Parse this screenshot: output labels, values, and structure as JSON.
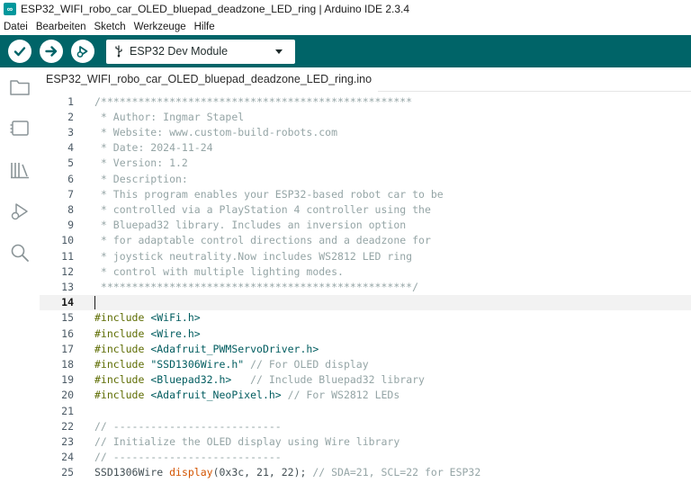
{
  "window": {
    "title": "ESP32_WIFI_robo_car_OLED_bluepad_deadzone_LED_ring | Arduino IDE 2.3.4",
    "app_icon": "arduino-logo-icon"
  },
  "menu": [
    "Datei",
    "Bearbeiten",
    "Sketch",
    "Werkzeuge",
    "Hilfe"
  ],
  "toolbar": {
    "verify_icon": "checkmark-icon",
    "upload_icon": "arrow-right-icon",
    "debug_icon": "debugger-icon",
    "board_icon": "usb-icon",
    "board_label": "ESP32 Dev Module",
    "accent_color": "#006468"
  },
  "sidebar": {
    "icons": [
      "folder-icon",
      "board-manager-icon",
      "library-icon",
      "debug-icon",
      "search-icon"
    ]
  },
  "tab": {
    "label": "ESP32_WIFI_robo_car_OLED_bluepad_deadzone_LED_ring.ino"
  },
  "editor": {
    "current_line": 14,
    "lines": [
      {
        "n": "1",
        "parts": [
          {
            "t": "/**************************************************",
            "c": "comment"
          }
        ]
      },
      {
        "n": "2",
        "parts": [
          {
            "t": " * Author: Ingmar Stapel",
            "c": "comment"
          }
        ]
      },
      {
        "n": "3",
        "parts": [
          {
            "t": " * Website: www.custom-build-robots.com",
            "c": "comment"
          }
        ]
      },
      {
        "n": "4",
        "parts": [
          {
            "t": " * Date: 2024-11-24",
            "c": "comment"
          }
        ]
      },
      {
        "n": "5",
        "parts": [
          {
            "t": " * Version: 1.2",
            "c": "comment"
          }
        ]
      },
      {
        "n": "6",
        "parts": [
          {
            "t": " * Description:",
            "c": "comment"
          }
        ]
      },
      {
        "n": "7",
        "parts": [
          {
            "t": " * This program enables your ESP32-based robot car to be",
            "c": "comment"
          }
        ]
      },
      {
        "n": "8",
        "parts": [
          {
            "t": " * controlled via a PlayStation 4 controller using the",
            "c": "comment"
          }
        ]
      },
      {
        "n": "9",
        "parts": [
          {
            "t": " * Bluepad32 library. Includes an inversion option",
            "c": "comment"
          }
        ]
      },
      {
        "n": "10",
        "parts": [
          {
            "t": " * for adaptable control directions and a deadzone for",
            "c": "comment"
          }
        ]
      },
      {
        "n": "11",
        "parts": [
          {
            "t": " * joystick neutrality.Now includes WS2812 LED ring",
            "c": "comment"
          }
        ]
      },
      {
        "n": "12",
        "parts": [
          {
            "t": " * control with multiple lighting modes.",
            "c": "comment"
          }
        ]
      },
      {
        "n": "13",
        "parts": [
          {
            "t": " **************************************************/",
            "c": "comment"
          }
        ]
      },
      {
        "n": "14",
        "parts": [
          {
            "t": "",
            "c": "plain"
          }
        ]
      },
      {
        "n": "15",
        "parts": [
          {
            "t": "#include",
            "c": "kw"
          },
          {
            "t": " <WiFi.h>",
            "c": "str"
          }
        ]
      },
      {
        "n": "16",
        "parts": [
          {
            "t": "#include",
            "c": "kw"
          },
          {
            "t": " <Wire.h>",
            "c": "str"
          }
        ]
      },
      {
        "n": "17",
        "parts": [
          {
            "t": "#include",
            "c": "kw"
          },
          {
            "t": " <Adafruit_PWMServoDriver.h>",
            "c": "str"
          }
        ]
      },
      {
        "n": "18",
        "parts": [
          {
            "t": "#include",
            "c": "kw"
          },
          {
            "t": " \"SSD1306Wire.h\"",
            "c": "str"
          },
          {
            "t": " // For OLED display",
            "c": "comment"
          }
        ]
      },
      {
        "n": "19",
        "parts": [
          {
            "t": "#include",
            "c": "kw"
          },
          {
            "t": " <Bluepad32.h>",
            "c": "str"
          },
          {
            "t": "   // Include Bluepad32 library",
            "c": "comment"
          }
        ]
      },
      {
        "n": "20",
        "parts": [
          {
            "t": "#include",
            "c": "kw"
          },
          {
            "t": " <Adafruit_NeoPixel.h>",
            "c": "str"
          },
          {
            "t": " // For WS2812 LEDs",
            "c": "comment"
          }
        ]
      },
      {
        "n": "21",
        "parts": [
          {
            "t": "",
            "c": "plain"
          }
        ]
      },
      {
        "n": "22",
        "parts": [
          {
            "t": "// ---------------------------",
            "c": "comment"
          }
        ]
      },
      {
        "n": "23",
        "parts": [
          {
            "t": "// Initialize the OLED display using Wire library",
            "c": "comment"
          }
        ]
      },
      {
        "n": "24",
        "parts": [
          {
            "t": "// ---------------------------",
            "c": "comment"
          }
        ]
      },
      {
        "n": "25",
        "parts": [
          {
            "t": "SSD1306Wire ",
            "c": "plain"
          },
          {
            "t": "display",
            "c": "fn"
          },
          {
            "t": "(0x3c, 21, 22); ",
            "c": "plain"
          },
          {
            "t": "// SDA=21, SCL=22 for ESP32",
            "c": "comment"
          }
        ]
      }
    ]
  }
}
